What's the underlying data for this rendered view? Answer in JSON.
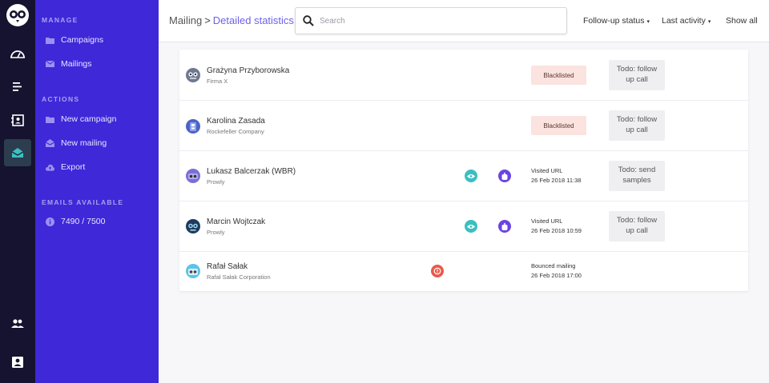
{
  "sidebar": {
    "sections": [
      {
        "title": "MANAGE"
      },
      {
        "title": "ACTIONS"
      },
      {
        "title": "EMAILS AVAILABLE"
      }
    ],
    "manage": [
      {
        "label": "Campaigns",
        "icon": "folder-icon"
      },
      {
        "label": "Mailings",
        "icon": "mail-icon"
      }
    ],
    "actions": [
      {
        "label": "New campaign",
        "icon": "folder-icon"
      },
      {
        "label": "New mailing",
        "icon": "open-mail-icon"
      },
      {
        "label": "Export",
        "icon": "cloud-upload-icon"
      }
    ],
    "emails_available": {
      "label": "7490 / 7500",
      "icon": "info-icon"
    }
  },
  "header": {
    "breadcrumb": {
      "root": "Mailing",
      "separator": ">",
      "current": "Detailed statistics"
    },
    "search": {
      "placeholder": "Search"
    },
    "filters": {
      "followup": "Follow-up status",
      "last_activity": "Last activity",
      "show_all": "Show all"
    }
  },
  "contacts": [
    {
      "name": "Grażyna Przyborowska",
      "company": "Firma X",
      "badge": "Blacklisted",
      "todo": [
        "Todo: follow",
        "up call"
      ]
    },
    {
      "name": "Karolina Zasada",
      "company": "Rockefeller Company",
      "badge": "Blacklisted",
      "todo": [
        "Todo: follow",
        "up call"
      ]
    },
    {
      "name": "Lukasz Balcerzak (WBR)",
      "company": "Prowly",
      "activity": "Visited URL",
      "date": "26 Feb 2018 11:38",
      "todo": [
        "Todo: send",
        "samples"
      ]
    },
    {
      "name": "Marcin Wojtczak",
      "company": "Prowly",
      "activity": "Visited URL",
      "date": "26 Feb 2018 10:59",
      "todo": [
        "Todo: follow",
        "up call"
      ]
    },
    {
      "name": "Rafał Sałak",
      "company": "Rafał Sałak Corporation",
      "activity": "Bounced mailing",
      "date": "26 Feb 2018 17:00"
    }
  ],
  "colors": {
    "rail": "#15132f",
    "sidebar": "#3e28d8",
    "accent": "#6b63e8",
    "opened": "#3bbfc0",
    "clicked": "#6a45e0",
    "bounced": "#e8594a",
    "blacklisted_bg": "#fbe3df"
  }
}
